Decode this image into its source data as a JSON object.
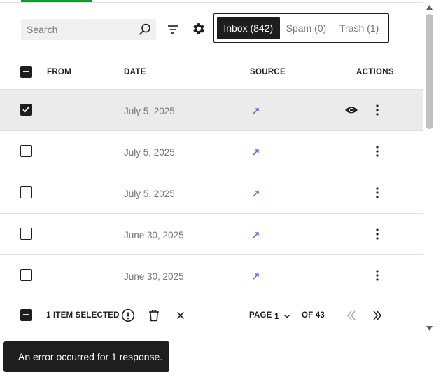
{
  "search": {
    "placeholder": "Search"
  },
  "tabs": [
    {
      "label": "Inbox (842)",
      "active": true
    },
    {
      "label": "Spam (0)",
      "active": false
    },
    {
      "label": "Trash (1)",
      "active": false
    }
  ],
  "columns": {
    "from": "FROM",
    "date": "DATE",
    "source": "SOURCE",
    "actions": "ACTIONS"
  },
  "rows": [
    {
      "from": "",
      "date": "July 5, 2025",
      "source_icon": "external-link-icon",
      "checked": true
    },
    {
      "from": "",
      "date": "July 5, 2025",
      "source_icon": "external-link-icon",
      "checked": false
    },
    {
      "from": "",
      "date": "July 5, 2025",
      "source_icon": "external-link-icon",
      "checked": false
    },
    {
      "from": "",
      "date": "June 30, 2025",
      "source_icon": "external-link-icon",
      "checked": false
    },
    {
      "from": "",
      "date": "June 30, 2025",
      "source_icon": "external-link-icon",
      "checked": false
    }
  ],
  "footer": {
    "selected_text": "1 ITEM SELECTED",
    "page_label": "PAGE",
    "page_value": "1",
    "of_label": "OF 43"
  },
  "snackbar": {
    "message": "An error occurred for 1 response."
  },
  "colors": {
    "accent": "#00a32a",
    "dark": "#1e1e1e",
    "link": "#3858e9",
    "muted": "#757575",
    "selected_row": "#ebebeb"
  }
}
